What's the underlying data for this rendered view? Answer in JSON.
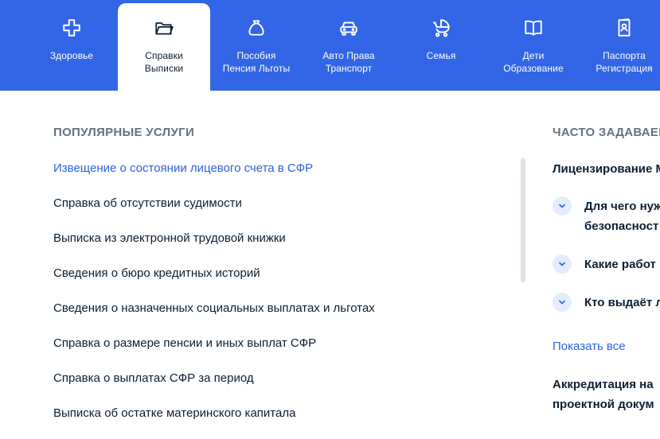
{
  "topnav": {
    "tabs": [
      {
        "icon": "plus-cross-icon",
        "line1": "Здоровье",
        "line2": ""
      },
      {
        "icon": "folder-icon",
        "line1": "Справки",
        "line2": "Выписки",
        "active": true
      },
      {
        "icon": "money-bag-icon",
        "line1": "Пособия",
        "line2": "Пенсия Льготы"
      },
      {
        "icon": "car-icon",
        "line1": "Авто Права",
        "line2": "Транспорт"
      },
      {
        "icon": "stroller-icon",
        "line1": "Семья",
        "line2": ""
      },
      {
        "icon": "book-icon",
        "line1": "Дети",
        "line2": "Образование"
      },
      {
        "icon": "passport-icon",
        "line1": "Паспорта",
        "line2": "Регистрация"
      }
    ]
  },
  "popular": {
    "title": "ПОПУЛЯРНЫЕ УСЛУГИ",
    "items": [
      "Извещение о состоянии лицевого счета в СФР",
      "Справка об отсутствии судимости",
      "Выписка из электронной трудовой книжки",
      "Сведения о бюро кредитных историй",
      "Сведения о назначенных социальных выплатах и льготах",
      "Справка о размере пенсии и иных выплат СФР",
      "Справка о выплатах СФР за период",
      "Выписка об остатке материнского капитала"
    ]
  },
  "faq": {
    "title": "ЧАСТО ЗАДАВАЕМ",
    "group1": "Лицензирование М",
    "questions": [
      {
        "line1": "Для чего нуж",
        "line2": "безопасност"
      },
      {
        "line1": "Какие работ",
        "line2": ""
      },
      {
        "line1": "Кто выдаёт л",
        "line2": ""
      }
    ],
    "show_all": "Показать все",
    "group2_line1": "Аккредитация на",
    "group2_line2": "проектной докум"
  },
  "colors": {
    "nav_bg": "#3366e6",
    "link": "#2c63d8",
    "text": "#0b1f33",
    "muted": "#66727f",
    "chevron_bg": "#e4ecfd"
  }
}
